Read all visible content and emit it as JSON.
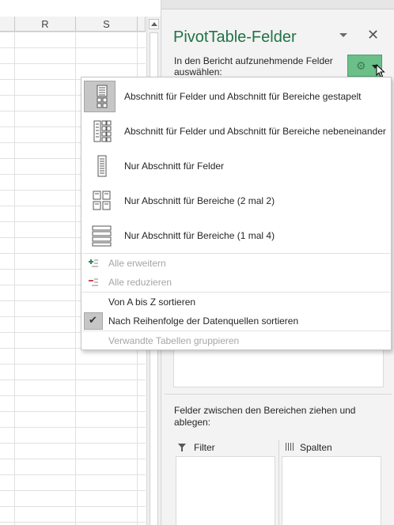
{
  "sheet": {
    "columns": [
      "R",
      "S"
    ]
  },
  "pane": {
    "title": "PivotTable-Felder",
    "subtitle": "In den Bericht aufzunehmende Felder auswählen:",
    "close_glyph": "✕",
    "gear_icon": "gear-icon",
    "drag_hint": "Felder zwischen den Bereichen ziehen und ablegen:",
    "areas": {
      "filter_label": "Filter",
      "columns_label": "Spalten"
    },
    "accent_color": "#217346"
  },
  "menu": {
    "layout_options": [
      {
        "label": "Abschnitt für Felder und Abschnitt für Bereiche gestapelt",
        "icon": "layout-stacked-icon",
        "selected": true
      },
      {
        "label": "Abschnitt für Felder und Abschnitt für Bereiche nebeneinander",
        "icon": "layout-side-by-side-icon",
        "selected": false
      },
      {
        "label": "Nur Abschnitt für Felder",
        "icon": "layout-fields-only-icon",
        "selected": false
      },
      {
        "label": "Nur Abschnitt für Bereiche (2 mal 2)",
        "icon": "layout-areas-2x2-icon",
        "selected": false
      },
      {
        "label": "Nur Abschnitt für Bereiche (1 mal 4)",
        "icon": "layout-areas-1x4-icon",
        "selected": false
      }
    ],
    "expand_all": "Alle erweitern",
    "collapse_all": "Alle reduzieren",
    "sort_az": "Von A bis Z sortieren",
    "sort_source": "Nach Reihenfolge der Datenquellen sortieren",
    "sort_source_checked": true,
    "group_related": "Verwandte Tabellen gruppieren"
  }
}
